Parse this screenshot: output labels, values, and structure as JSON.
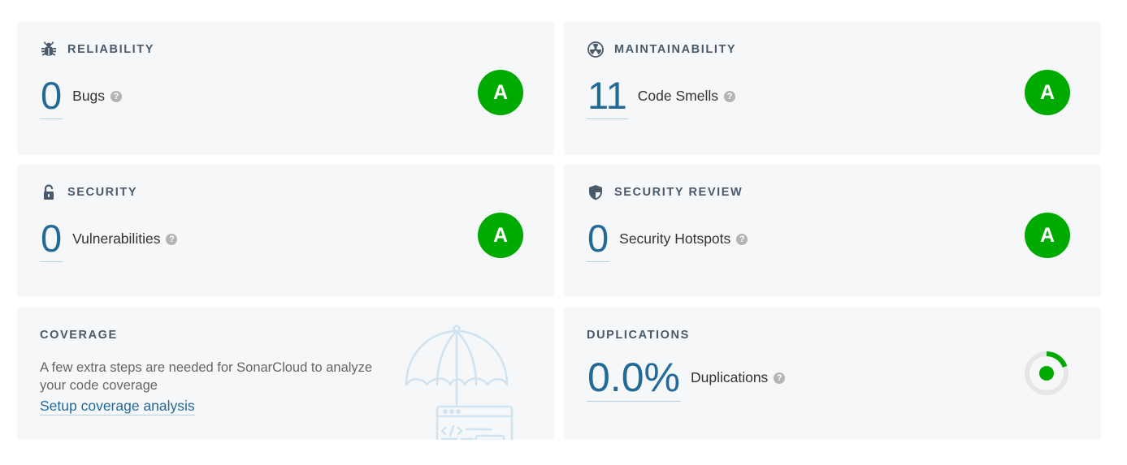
{
  "reliability": {
    "title": "RELIABILITY",
    "value": "0",
    "label": "Bugs",
    "rating": "A",
    "icon": "bug-icon"
  },
  "maintainability": {
    "title": "MAINTAINABILITY",
    "value": "11",
    "label": "Code Smells",
    "rating": "A",
    "icon": "radiation-icon"
  },
  "security": {
    "title": "SECURITY",
    "value": "0",
    "label": "Vulnerabilities",
    "rating": "A",
    "icon": "lock-open-icon"
  },
  "security_review": {
    "title": "SECURITY REVIEW",
    "value": "0",
    "label": "Security Hotspots",
    "rating": "A",
    "icon": "shield-icon"
  },
  "coverage": {
    "title": "COVERAGE",
    "message": "A few extra steps are needed for SonarCloud to analyze your code coverage",
    "link_label": "Setup coverage analysis",
    "illustration": "umbrella-code-illustration"
  },
  "duplications": {
    "title": "DUPLICATIONS",
    "value": "0.0%",
    "label": "Duplications",
    "ratio": 0.0,
    "indicator": "duplications-donut-icon"
  },
  "help_glyph": "?",
  "colors": {
    "rating_a": "#00aa00",
    "metric_value": "#236a97",
    "card_bg": "#f5f7f9",
    "title": "#4a5a6a"
  }
}
